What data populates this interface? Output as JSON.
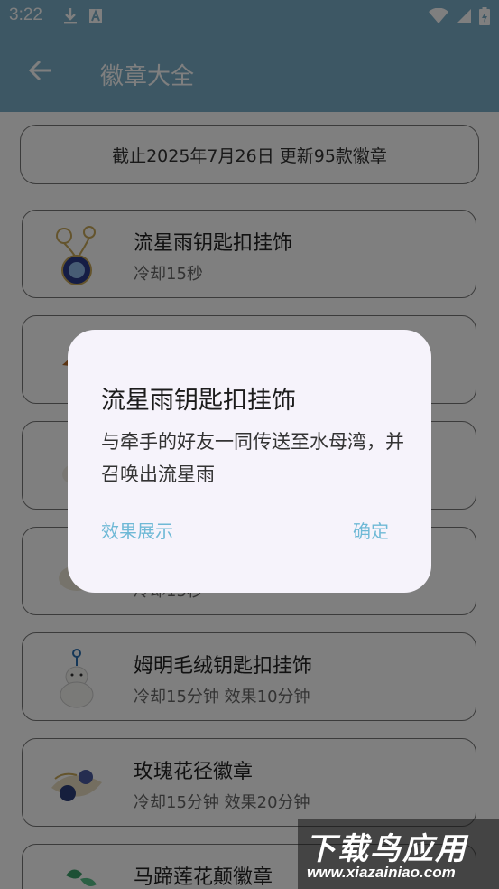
{
  "status_bar": {
    "time": "3:22"
  },
  "app_bar": {
    "title": "徽章大全"
  },
  "notice": "截止2025年7月26日 更新95款徽章",
  "badges": [
    {
      "name": "流星雨钥匙扣挂饰",
      "desc": "冷却15秒"
    },
    {
      "name": "",
      "desc": ""
    },
    {
      "name": "",
      "desc": ""
    },
    {
      "name": "",
      "desc": "冷却15秒"
    },
    {
      "name": "姆明毛绒钥匙扣挂饰",
      "desc": "冷却15分钟 效果10分钟"
    },
    {
      "name": "玫瑰花径徽章",
      "desc": "冷却15分钟 效果20分钟"
    },
    {
      "name": "马蹄莲花颠徽章",
      "desc": ""
    }
  ],
  "dialog": {
    "title": "流星雨钥匙扣挂饰",
    "body": "与牵手的好友一同传送至水母湾，并召唤出流星雨",
    "left_button": "效果展示",
    "right_button": "确定"
  },
  "watermark": {
    "main": "下载鸟应用",
    "url": "www.xiazainiao.com"
  },
  "colors": {
    "app_bar": "#7aaec8",
    "dialog_bg": "#f6f3fb",
    "dialog_button": "#6fb9d6"
  }
}
